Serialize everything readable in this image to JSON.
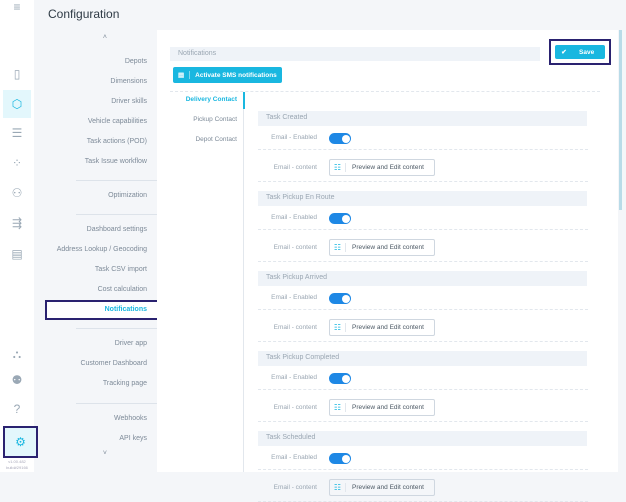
{
  "header": {
    "title": "Configuration"
  },
  "rail": {
    "items": [
      "menu-icon",
      "map-icon",
      "cube-icon",
      "list-icon",
      "routes-icon",
      "user-icon",
      "truck-icon",
      "store-icon",
      "network-icon",
      "users-icon",
      "help-icon",
      "gear-icon"
    ],
    "version": "v1.00.482",
    "build": "build#29166"
  },
  "nav": {
    "items": [
      {
        "label": "Depots"
      },
      {
        "label": "Dimensions"
      },
      {
        "label": "Driver skills"
      },
      {
        "label": "Vehicle capabilities"
      },
      {
        "label": "Task actions (POD)"
      },
      {
        "label": "Task Issue workflow"
      },
      {
        "label": "Optimization"
      },
      {
        "label": "Dashboard settings"
      },
      {
        "label": "Address Lookup / Geocoding"
      },
      {
        "label": "Task CSV import"
      },
      {
        "label": "Cost calculation"
      },
      {
        "label": "Notifications"
      },
      {
        "label": "Driver app"
      },
      {
        "label": "Customer Dashboard"
      },
      {
        "label": "Tracking page"
      },
      {
        "label": "Webhooks"
      },
      {
        "label": "API keys"
      }
    ],
    "active": "Notifications"
  },
  "main": {
    "section_title": "Notifications",
    "sms_button": "Activate SMS notifications",
    "save_button": "Save",
    "tabs": [
      {
        "label": "Delivery Contact"
      },
      {
        "label": "Pickup Contact"
      },
      {
        "label": "Depot Contact"
      }
    ],
    "enabled_label": "Email - Enabled",
    "content_label": "Email - content",
    "preview_button": "Preview and Edit content",
    "sections": [
      {
        "title": "Task Created",
        "enabled": true
      },
      {
        "title": "Task Pickup En Route",
        "enabled": true
      },
      {
        "title": "Task Pickup Arrived",
        "enabled": true
      },
      {
        "title": "Task Pickup Completed",
        "enabled": true
      },
      {
        "title": "Task Scheduled",
        "enabled": true
      }
    ]
  },
  "colors": {
    "accent": "#19b7e0",
    "toggle": "#1e88e5",
    "highlight": "#2a2270"
  }
}
